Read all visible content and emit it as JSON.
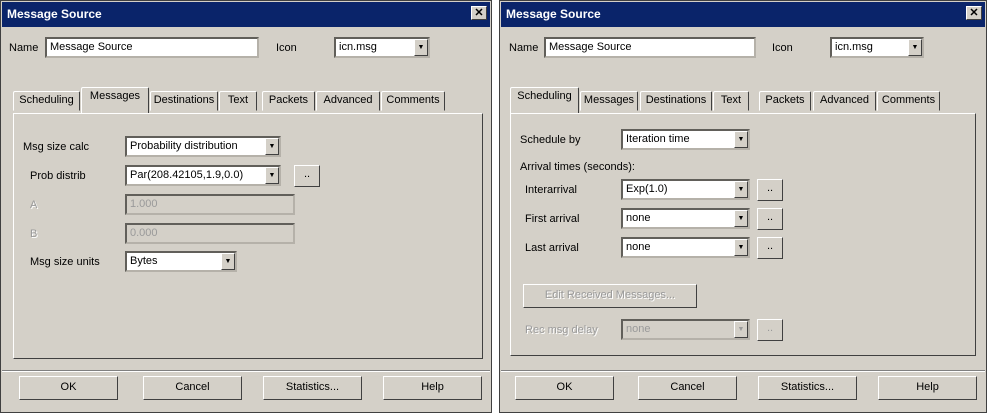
{
  "left": {
    "title": "Message Source",
    "close_glyph": "✕",
    "name_label": "Name",
    "name_value": "Message Source",
    "icon_label": "Icon",
    "icon_value": "icn.msg",
    "tabs": [
      "Scheduling",
      "Messages",
      "Destinations",
      "Text",
      "Packets",
      "Advanced",
      "Comments"
    ],
    "active_tab": "Messages",
    "msg_size_calc_label": "Msg size calc",
    "msg_size_calc_value": "Probability distribution",
    "prob_distrib_label": "Prob distrib",
    "prob_distrib_value": "Par(208.42105,1.9,0.0)",
    "a_label": "A",
    "a_value": "1.000",
    "b_label": "B",
    "b_value": "0.000",
    "msg_size_units_label": "Msg size units",
    "msg_size_units_value": "Bytes",
    "dots_label": "..",
    "buttons": {
      "ok": "OK",
      "cancel": "Cancel",
      "statistics": "Statistics...",
      "help": "Help"
    }
  },
  "right": {
    "title": "Message Source",
    "close_glyph": "✕",
    "name_label": "Name",
    "name_value": "Message Source",
    "icon_label": "Icon",
    "icon_value": "icn.msg",
    "tabs": [
      "Scheduling",
      "Messages",
      "Destinations",
      "Text",
      "Packets",
      "Advanced",
      "Comments"
    ],
    "active_tab": "Scheduling",
    "schedule_by_label": "Schedule by",
    "schedule_by_value": "Iteration time",
    "arrival_times_label": "Arrival times (seconds):",
    "interarrival_label": "Interarrival",
    "interarrival_value": "Exp(1.0)",
    "first_arrival_label": "First arrival",
    "first_arrival_value": "none",
    "last_arrival_label": "Last arrival",
    "last_arrival_value": "none",
    "edit_received_label": "Edit Received Messages...",
    "rec_msg_delay_label": "Rec msg delay",
    "rec_msg_delay_value": "none",
    "dots_label": "..",
    "buttons": {
      "ok": "OK",
      "cancel": "Cancel",
      "statistics": "Statistics...",
      "help": "Help"
    }
  },
  "dropdown_arrow": "▼",
  "colors": {
    "titlebar": "#0a246a",
    "face": "#d4d0c8",
    "disabled_text": "#9a9a9a"
  }
}
